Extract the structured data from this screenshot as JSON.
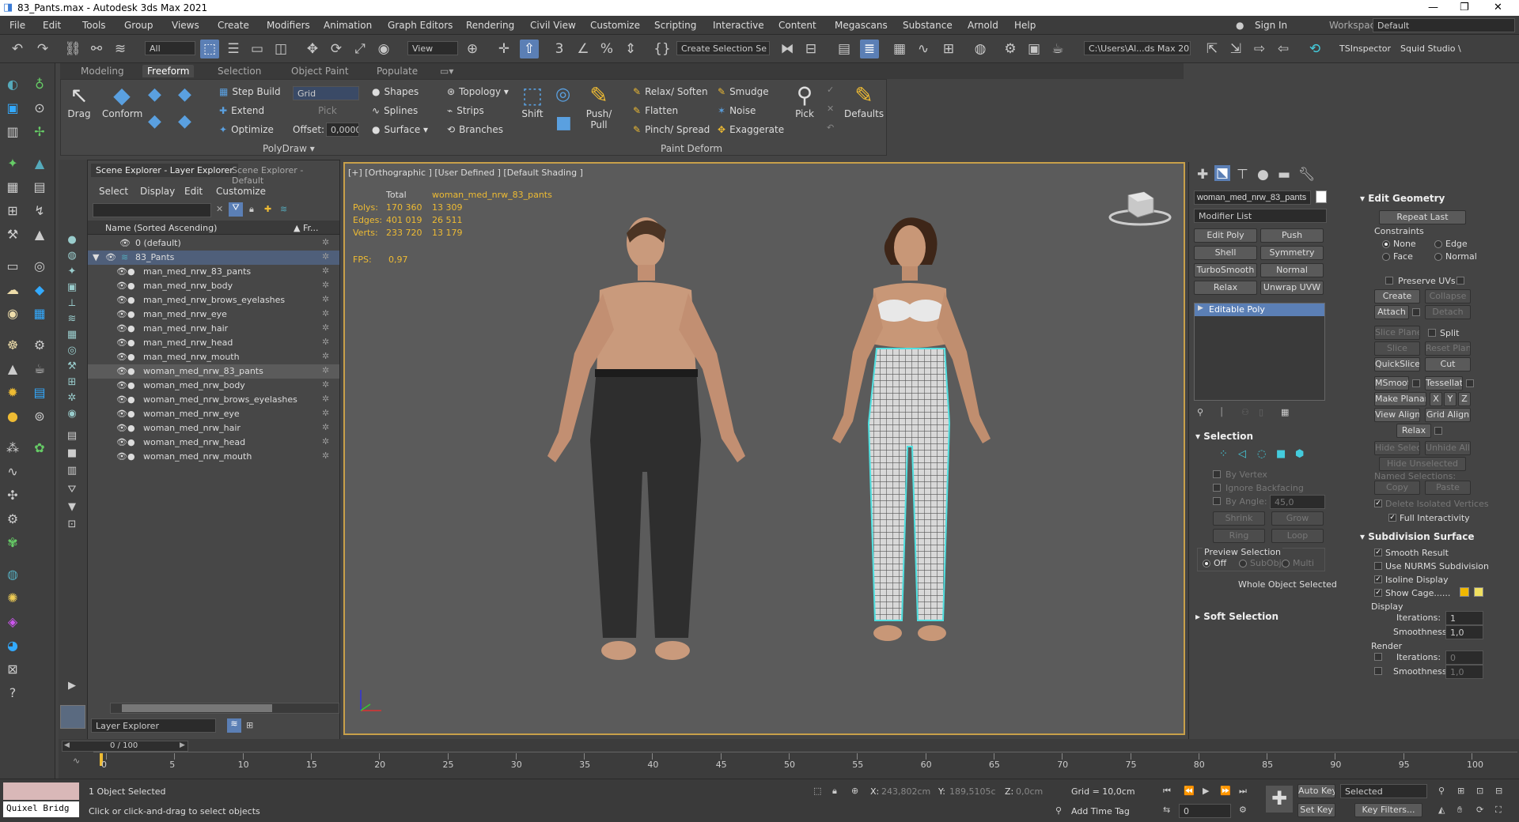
{
  "title": "83_Pants.max - Autodesk 3ds Max 2021",
  "window_controls": {
    "min": "—",
    "max": "❐",
    "close": "✕"
  },
  "menu": [
    "File",
    "Edit",
    "Tools",
    "Group",
    "Views",
    "Create",
    "Modifiers",
    "Animation",
    "Graph Editors",
    "Rendering",
    "Civil View",
    "Customize",
    "Scripting",
    "Interactive",
    "Content",
    "Megascans",
    "Substance",
    "Arnold",
    "Help"
  ],
  "account": {
    "signin": "Sign In",
    "workspaces_label": "Workspaces:",
    "workspace": "Default"
  },
  "toolbar": {
    "filter": "All",
    "view": "View",
    "selection_set": "Create Selection Se",
    "project_path": "C:\\Users\\Al...ds Max 202:",
    "plugin1": "TSInspector",
    "plugin2": "Squid Studio \\"
  },
  "ribbon_tabs": [
    "Modeling",
    "Freeform",
    "Selection",
    "Object Paint",
    "Populate"
  ],
  "ribbon": {
    "drag": "Drag",
    "conform": "Conform",
    "step_build": "Step Build",
    "extend": "Extend",
    "optimize": "Optimize",
    "grid": "Grid",
    "pick": "Pick",
    "offset_label": "Offset:",
    "offset": "0,0000",
    "polydraw": "PolyDraw ▾",
    "shapes": "Shapes",
    "splines": "Splines",
    "surface": "Surface ▾",
    "topology": "Topology ▾",
    "strips": "Strips",
    "branches": "Branches",
    "shift": "Shift",
    "push_pull": "Push/ Pull",
    "relax_soften": "Relax/ Soften",
    "flatten": "Flatten",
    "pinch_spread": "Pinch/ Spread",
    "smudge": "Smudge",
    "noise": "Noise",
    "exaggerate": "Exaggerate",
    "pick2": "Pick",
    "paint_deform": "Paint Deform",
    "defaults": "Defaults"
  },
  "scene_explorer": {
    "tab1": "Scene Explorer - Layer Explorer",
    "tab2": "Scene Explorer - Default",
    "menu": [
      "Select",
      "Display",
      "Edit",
      "Customize"
    ],
    "col_name": "Name (Sorted Ascending)",
    "col_fr": "▲ Fr...",
    "rows": [
      "0 (default)",
      "83_Pants",
      "man_med_nrw_83_pants",
      "man_med_nrw_body",
      "man_med_nrw_brows_eyelashes",
      "man_med_nrw_eye",
      "man_med_nrw_hair",
      "man_med_nrw_head",
      "man_med_nrw_mouth",
      "woman_med_nrw_83_pants",
      "woman_med_nrw_body",
      "woman_med_nrw_brows_eyelashes",
      "woman_med_nrw_eye",
      "woman_med_nrw_hair",
      "woman_med_nrw_head",
      "woman_med_nrw_mouth"
    ],
    "footer": "Layer Explorer"
  },
  "viewport": {
    "label": "[+] [Orthographic ] [User Defined ] [Default Shading ]",
    "stats": {
      "total": "Total",
      "object": "woman_med_nrw_83_pants",
      "polys_l": "Polys:",
      "polys_t": "170 360",
      "polys_o": "13 309",
      "edges_l": "Edges:",
      "edges_t": "401 019",
      "edges_o": "26 511",
      "verts_l": "Verts:",
      "verts_t": "233 720",
      "verts_o": "13 179",
      "fps_l": "FPS:",
      "fps": "0,97"
    }
  },
  "command_panel": {
    "object_name": "woman_med_nrw_83_pants",
    "modifier_list": "Modifier List",
    "mods": [
      "Edit Poly",
      "Push",
      "Shell",
      "Symmetry",
      "TurboSmooth",
      "Normal",
      "Relax",
      "Unwrap UVW"
    ],
    "stack_item": "Editable Poly",
    "selection": {
      "title": "Selection",
      "by_vertex": "By Vertex",
      "ignore_backfacing": "Ignore Backfacing",
      "by_angle": "By Angle:",
      "angle": "45,0",
      "shrink": "Shrink",
      "grow": "Grow",
      "ring": "Ring",
      "loop": "Loop",
      "preview": "Preview Selection",
      "off": "Off",
      "subobj": "SubObj",
      "multi": "Multi",
      "whole": "Whole Object Selected"
    },
    "soft_selection": "Soft Selection"
  },
  "edit_geometry": {
    "title": "Edit Geometry",
    "repeat_last": "Repeat Last",
    "constraints": "Constraints",
    "none": "None",
    "edge": "Edge",
    "face": "Face",
    "normal": "Normal",
    "preserve_uvs": "Preserve UVs",
    "create": "Create",
    "collapse": "Collapse",
    "attach": "Attach",
    "detach": "Detach",
    "slice_plane": "Slice Plane",
    "split": "Split",
    "slice": "Slice",
    "reset_plane": "Reset Plane",
    "quickslice": "QuickSlice",
    "cut": "Cut",
    "msmooth": "MSmooth",
    "tessellate": "Tessellate",
    "make_planar": "Make Planar",
    "x": "X",
    "y": "Y",
    "z": "Z",
    "view_align": "View Align",
    "grid_align": "Grid Align",
    "relax": "Relax",
    "hide_selected": "Hide Selected",
    "unhide_all": "Unhide All",
    "hide_unselected": "Hide Unselected",
    "named_selections": "Named Selections:",
    "copy": "Copy",
    "paste": "Paste",
    "delete_isolated": "Delete Isolated Vertices",
    "full_interactivity": "Full Interactivity"
  },
  "subdivision": {
    "title": "Subdivision Surface",
    "smooth_result": "Smooth Result",
    "nurms": "Use NURMS Subdivision",
    "isoline": "Isoline Display",
    "show_cage": "Show Cage......",
    "display": "Display",
    "iterations_l": "Iterations:",
    "iterations": "1",
    "smoothness_l": "Smoothness:",
    "smoothness": "1,0",
    "render": "Render",
    "r_iterations": "0",
    "r_smoothness": "1,0"
  },
  "timeline": {
    "frame": "0 / 100",
    "ticks": [
      "0",
      "5",
      "10",
      "15",
      "20",
      "25",
      "30",
      "35",
      "40",
      "45",
      "50",
      "55",
      "60",
      "65",
      "70",
      "75",
      "80",
      "85",
      "90",
      "95",
      "100"
    ]
  },
  "status": {
    "quixel": "Quixel Bridg",
    "selected": "1 Object Selected",
    "hint": "Click or click-and-drag to select objects",
    "x_l": "X:",
    "x": "243,802cm",
    "y_l": "Y:",
    "y": "189,5105c",
    "z_l": "Z:",
    "z": "0,0cm",
    "grid": "Grid = 10,0cm",
    "add_time_tag": "Add Time Tag",
    "auto_key": "Auto Key",
    "selected_dd": "Selected",
    "set_key": "Set Key",
    "key_filters": "Key Filters...",
    "frame_field": "0"
  },
  "colors": {
    "accent": "#5b7fb5",
    "wire": "#ffffff",
    "selection_outline": "#4fe0e0",
    "viewport_border": "#c8a04a"
  }
}
